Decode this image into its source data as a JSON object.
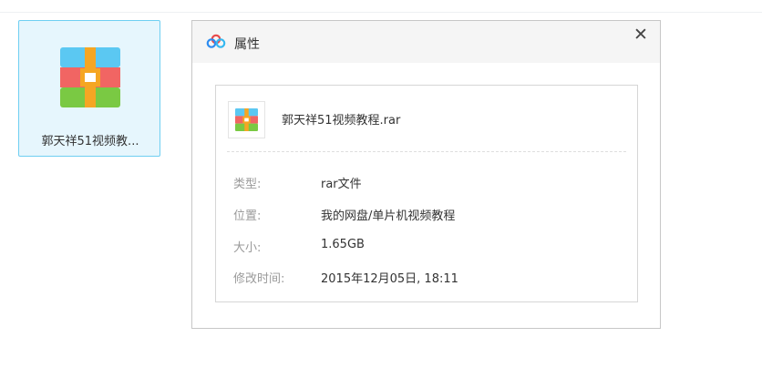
{
  "file_tile": {
    "label": "郭天祥51视频教..."
  },
  "dialog": {
    "title": "属性",
    "close_label": "✕",
    "file_name": "郭天祥51视频教程.rar",
    "rows": [
      {
        "key": "类型:",
        "value": "rar文件"
      },
      {
        "key": "位置:",
        "value": "我的网盘/单片机视频教程"
      },
      {
        "key": "大小:",
        "value": "1.65GB"
      },
      {
        "key": "修改时间:",
        "value": "2015年12月05日, 18:11"
      }
    ]
  },
  "icons": {
    "archive": "rar-archive-icon",
    "app_logo": "baidu-cloud-icon",
    "close": "close-icon"
  },
  "colors": {
    "tile_bg": "#e6f6fd",
    "tile_border": "#6fcff2",
    "archive_top": "#5bc8f2",
    "archive_middle": "#f16563",
    "archive_bottom": "#7ac943",
    "archive_band": "#f5a623"
  }
}
